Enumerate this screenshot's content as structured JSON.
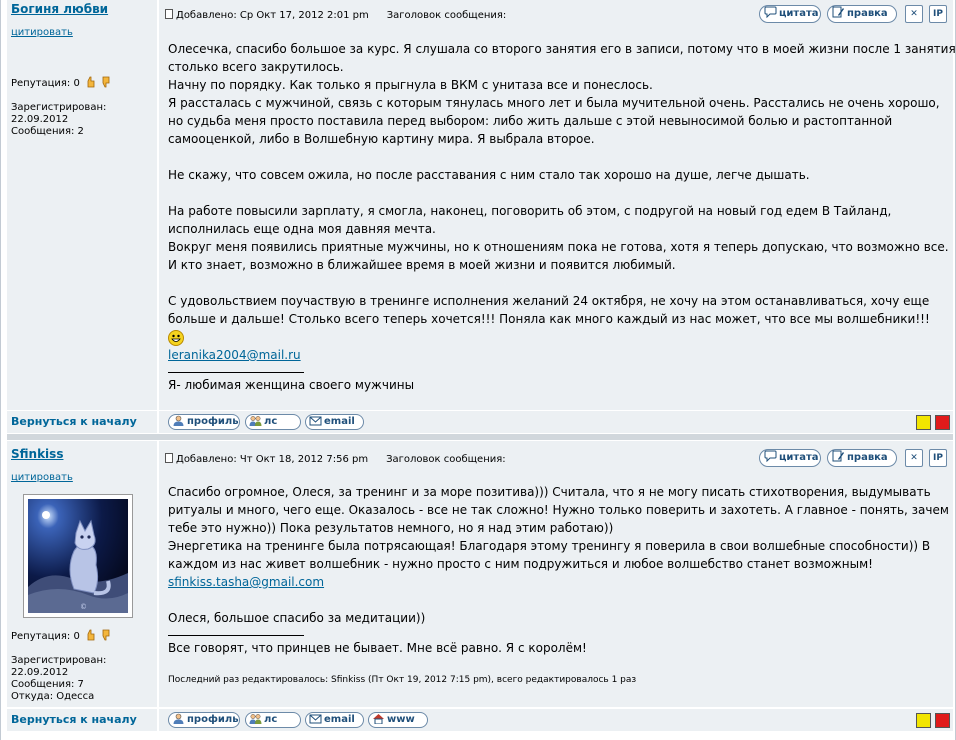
{
  "colors": {
    "accent": "#006699",
    "row_bg": "#ECF0F3",
    "separator": "#D1D7DC",
    "border": "#C2CAD3",
    "dot_yellow": "#F2E500",
    "dot_red": "#E11B1B"
  },
  "posts": [
    {
      "author": "Богиня любви",
      "quote_link": "цитировать",
      "reputation_label": "Репутация: 0",
      "registered_label": "Зарегистрирован:",
      "registered_date": "22.09.2012",
      "messages": "Сообщения: 2",
      "posted": "Добавлено: Ср Окт 17, 2012 2:01 pm",
      "subject_label": "Заголовок сообщения:",
      "buttons": {
        "quote": "цитата",
        "edit": "правка",
        "delete_icon": "delete-x-icon",
        "ip": "IP"
      },
      "body": [
        "Олесечка, спасибо большое за курс. Я слушала со второго занятия его в записи, потому что в моей жизни после 1 занятия столько всего закрутилось.",
        "Начну по порядку. Как только я прыгнула в ВКМ с унитаза все и понеслось.",
        "Я рассталась с мужчиной, связь с которым тянулась много лет и была мучительной очень. Расстались не очень хорошо, но судьба меня просто поставила перед выбором: либо жить дальше с этой невыносимой болью и растоптанной самооценкой, либо в Волшебную картину мира. Я выбрала второе.",
        "Не скажу, что совсем ожила, но после расставания с ним стало так хорошо на душе, легче дышать.",
        "На работе повысили зарплату, я смогла, наконец, поговорить об этом, с подругой на новый год едем В Тайланд, исполнилась еще одна моя давняя мечта.",
        "Вокруг меня появились приятные мужчины, но к отношениям пока не готова, хотя я теперь допускаю, что возможно все. И кто знает, возможно в ближайшее время в моей жизни и появится любимый.",
        "С удовольствием поучаствую в тренинге исполнения желаний 24 октября, не хочу на этом останавливаться, хочу еще больше и дальше! Столько всего теперь хочется!!! Поняла как много каждый из нас может, что все мы волшебники!!!"
      ],
      "email_text": "leranika2004@mail.ru",
      "signature": "Я- любимая женщина своего мужчины",
      "footer": {
        "back": "Вернуться к началу",
        "profile": "профиль",
        "pm": "лс",
        "email": "email"
      }
    },
    {
      "author": "Sfinkiss",
      "quote_link": "цитировать",
      "reputation_label": "Репутация: 0",
      "registered_label": "Зарегистрирован:",
      "registered_date": "22.09.2012",
      "messages": "Сообщения: 7",
      "location": "Откуда: Одесса",
      "posted": "Добавлено: Чт Окт 18, 2012 7:56 pm",
      "subject_label": "Заголовок сообщения:",
      "buttons": {
        "quote": "цитата",
        "edit": "правка",
        "delete_icon": "delete-x-icon",
        "ip": "IP"
      },
      "body": [
        "Спасибо огромное, Олеся, за тренинг и за море позитива))) Считала, что я не могу писать стихотворения, выдумывать ритуалы и много, чего еще. Оказалось - все не так сложно! Нужно только поверить и захотеть. А главное - понять, зачем тебе это нужно)) Пока результатов немного, но я над этим работаю))",
        "Энергетика на тренинге была потрясающая! Благодаря этому тренингу я поверила в свои волшебные способности)) В каждом из нас живет волшебник - нужно просто с ним подружиться и любое волшебство станет возможным!"
      ],
      "email_text": "sfinkiss.tasha@gmail.com",
      "body_after": "Олеся, большое спасибо за медитации))",
      "signature": "Все говорят, что принцев не бывает. Мне всё равно. Я с королём!",
      "edited_note": "Последний раз редактировалось: Sfinkiss (Пт Окт 19, 2012 7:15 pm), всего редактировалось 1 раз",
      "footer": {
        "back": "Вернуться к началу",
        "profile": "профиль",
        "pm": "лс",
        "email": "email",
        "www": "www"
      }
    }
  ]
}
